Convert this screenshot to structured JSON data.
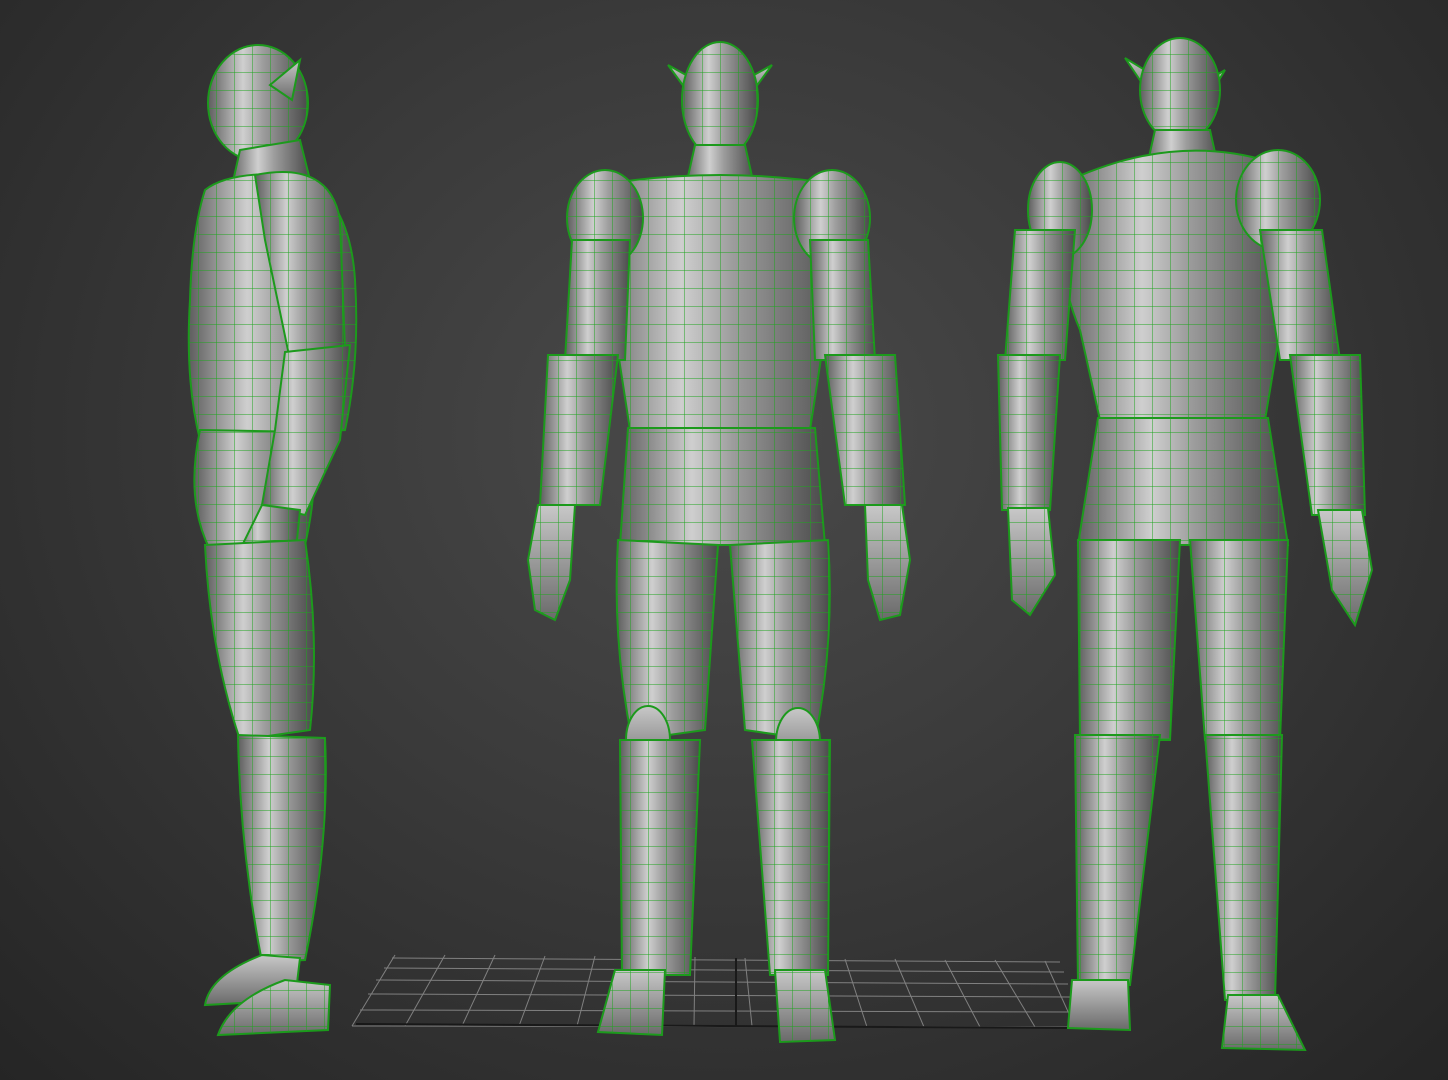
{
  "viewport": {
    "background_color": "#3a3a3a",
    "wireframe_color": "#1f9e1f",
    "mesh_color": "#a9a9a9",
    "grid_color": "#b4b4b4"
  },
  "models": [
    {
      "view": "side"
    },
    {
      "view": "front"
    },
    {
      "view": "back"
    }
  ]
}
